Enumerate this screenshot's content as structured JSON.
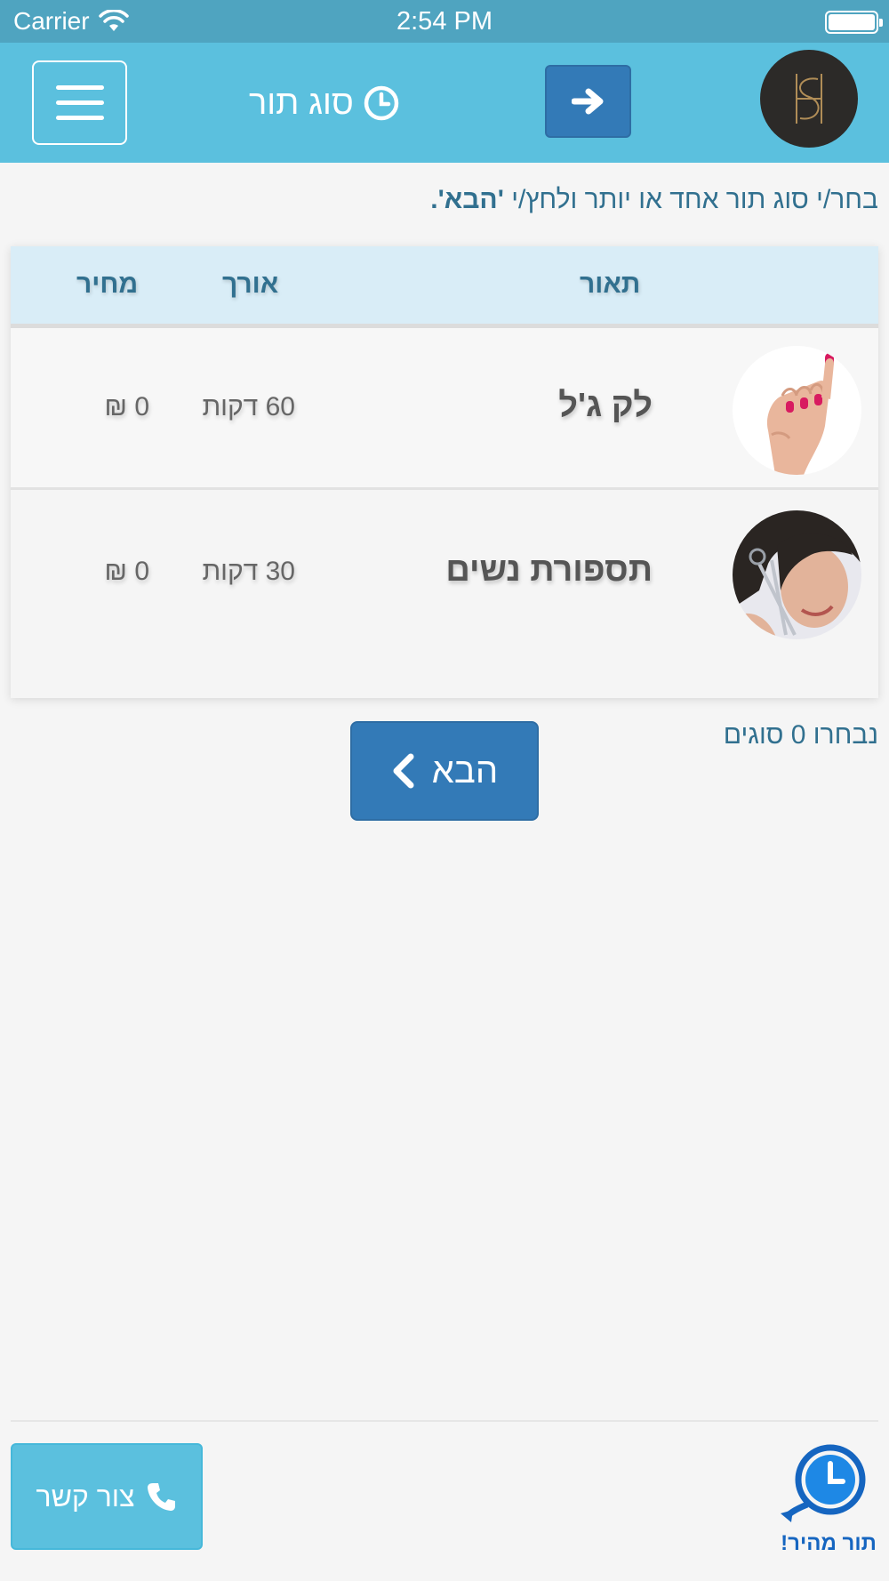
{
  "status_bar": {
    "carrier": "Carrier",
    "time": "2:54 PM"
  },
  "header": {
    "title": "סוג תור",
    "icons": [
      "menu-icon",
      "clock-icon",
      "arrow-right-icon"
    ]
  },
  "instruction": {
    "prefix": "בחר/י סוג תור אחד או יותר ולחץ/י",
    "emphasis": "'הבא'."
  },
  "table": {
    "headers": {
      "description": "תאור",
      "length": "אורך",
      "price": "מחיר"
    },
    "rows": [
      {
        "name": "לק ג'ל",
        "length": "60 דקות",
        "price": "0 ₪",
        "image": "hand-nails-photo"
      },
      {
        "name": "תספורת נשים",
        "length": "30 דקות",
        "price": "0 ₪",
        "image": "woman-haircut-photo"
      }
    ]
  },
  "selection": {
    "count_text": "נבחרו 0 סוגים"
  },
  "next_button": {
    "label": "הבא",
    "icon": "chevron-left-icon"
  },
  "footer": {
    "contact_label": "צור קשר",
    "contact_icon": "phone-icon",
    "brand_text": "תור מהיר!"
  },
  "colors": {
    "status_bar": "#4fa4c0",
    "header": "#5bc0de",
    "primary": "#337ab7",
    "info_text": "#31708f",
    "table_header": "#d9edf7",
    "contact_button": "#5bc0de",
    "brand": "#1565c0"
  }
}
